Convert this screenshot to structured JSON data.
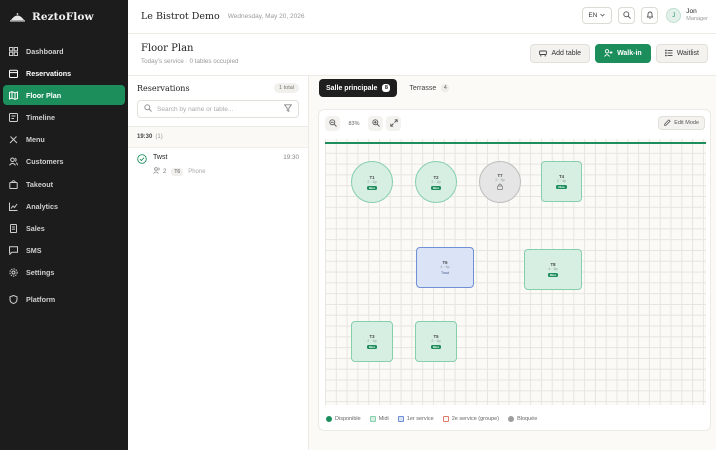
{
  "brand": {
    "name": "ReztoFlow"
  },
  "sidebar": {
    "items": [
      {
        "label": "Dashboard"
      },
      {
        "label": "Reservations"
      },
      {
        "label": "Floor Plan"
      },
      {
        "label": "Timeline"
      },
      {
        "label": "Menu"
      },
      {
        "label": "Customers"
      },
      {
        "label": "Takeout"
      },
      {
        "label": "Analytics"
      },
      {
        "label": "Sales"
      },
      {
        "label": "SMS"
      },
      {
        "label": "Settings"
      },
      {
        "label": "Platform"
      }
    ]
  },
  "topbar": {
    "restaurant": "Le Bistrot Demo",
    "date": "Wednesday, May 20, 2026",
    "language": "EN",
    "user_initial": "J",
    "user_name": "Jon",
    "user_role": "Manager"
  },
  "header": {
    "title": "Floor Plan",
    "subtitle": "Today's service · 0 tables occupied",
    "add_table": "Add table",
    "walk_in": "Walk-in",
    "waitlist": "Waitlist"
  },
  "reservations": {
    "title": "Reservations",
    "count": "1 total",
    "search_placeholder": "Search by name or table...",
    "slots": [
      {
        "time": "19:30",
        "count": "(1)",
        "items": [
          {
            "name": "Twst",
            "time": "19:30",
            "guests": "2",
            "table": "T6",
            "source": "Phone"
          }
        ]
      }
    ]
  },
  "floor": {
    "tabs": [
      {
        "label": "Salle principale",
        "count": "8"
      },
      {
        "label": "Terrasse",
        "count": "4"
      }
    ],
    "zoom": "83%",
    "edit_mode": "Edit Mode",
    "tables": [
      {
        "name": "T1",
        "cap": "2 · 4p",
        "badge": "libre",
        "status": "available"
      },
      {
        "name": "T2",
        "cap": "2 · 4p",
        "badge": "libre",
        "status": "available"
      },
      {
        "name": "T7",
        "cap": "2 · 4p",
        "status": "blocked"
      },
      {
        "name": "T4",
        "cap": "2 · 4p",
        "badge": "libre",
        "status": "available"
      },
      {
        "name": "T6",
        "cap": "4 · 6p",
        "guest": "Twst",
        "status": "seated"
      },
      {
        "name": "T8",
        "cap": "4 · 6p",
        "badge": "libre",
        "status": "available"
      },
      {
        "name": "T3",
        "cap": "2 · 4p",
        "badge": "libre",
        "status": "available"
      },
      {
        "name": "T5",
        "cap": "2 · 4p",
        "badge": "libre",
        "status": "available"
      }
    ],
    "legend": [
      {
        "label": "Disponible",
        "color": "#1b8e5b"
      },
      {
        "label": "Midi",
        "color": "#86cfab"
      },
      {
        "label": "1er service",
        "color": "#6f8fd6"
      },
      {
        "label": "2e service (groupe)",
        "color": "#e07a6a"
      },
      {
        "label": "Bloquée",
        "color": "#9e9e9e"
      }
    ]
  },
  "colors": {
    "accent": "#1b8e5b",
    "sidebar_bg": "#1c1c1c"
  }
}
